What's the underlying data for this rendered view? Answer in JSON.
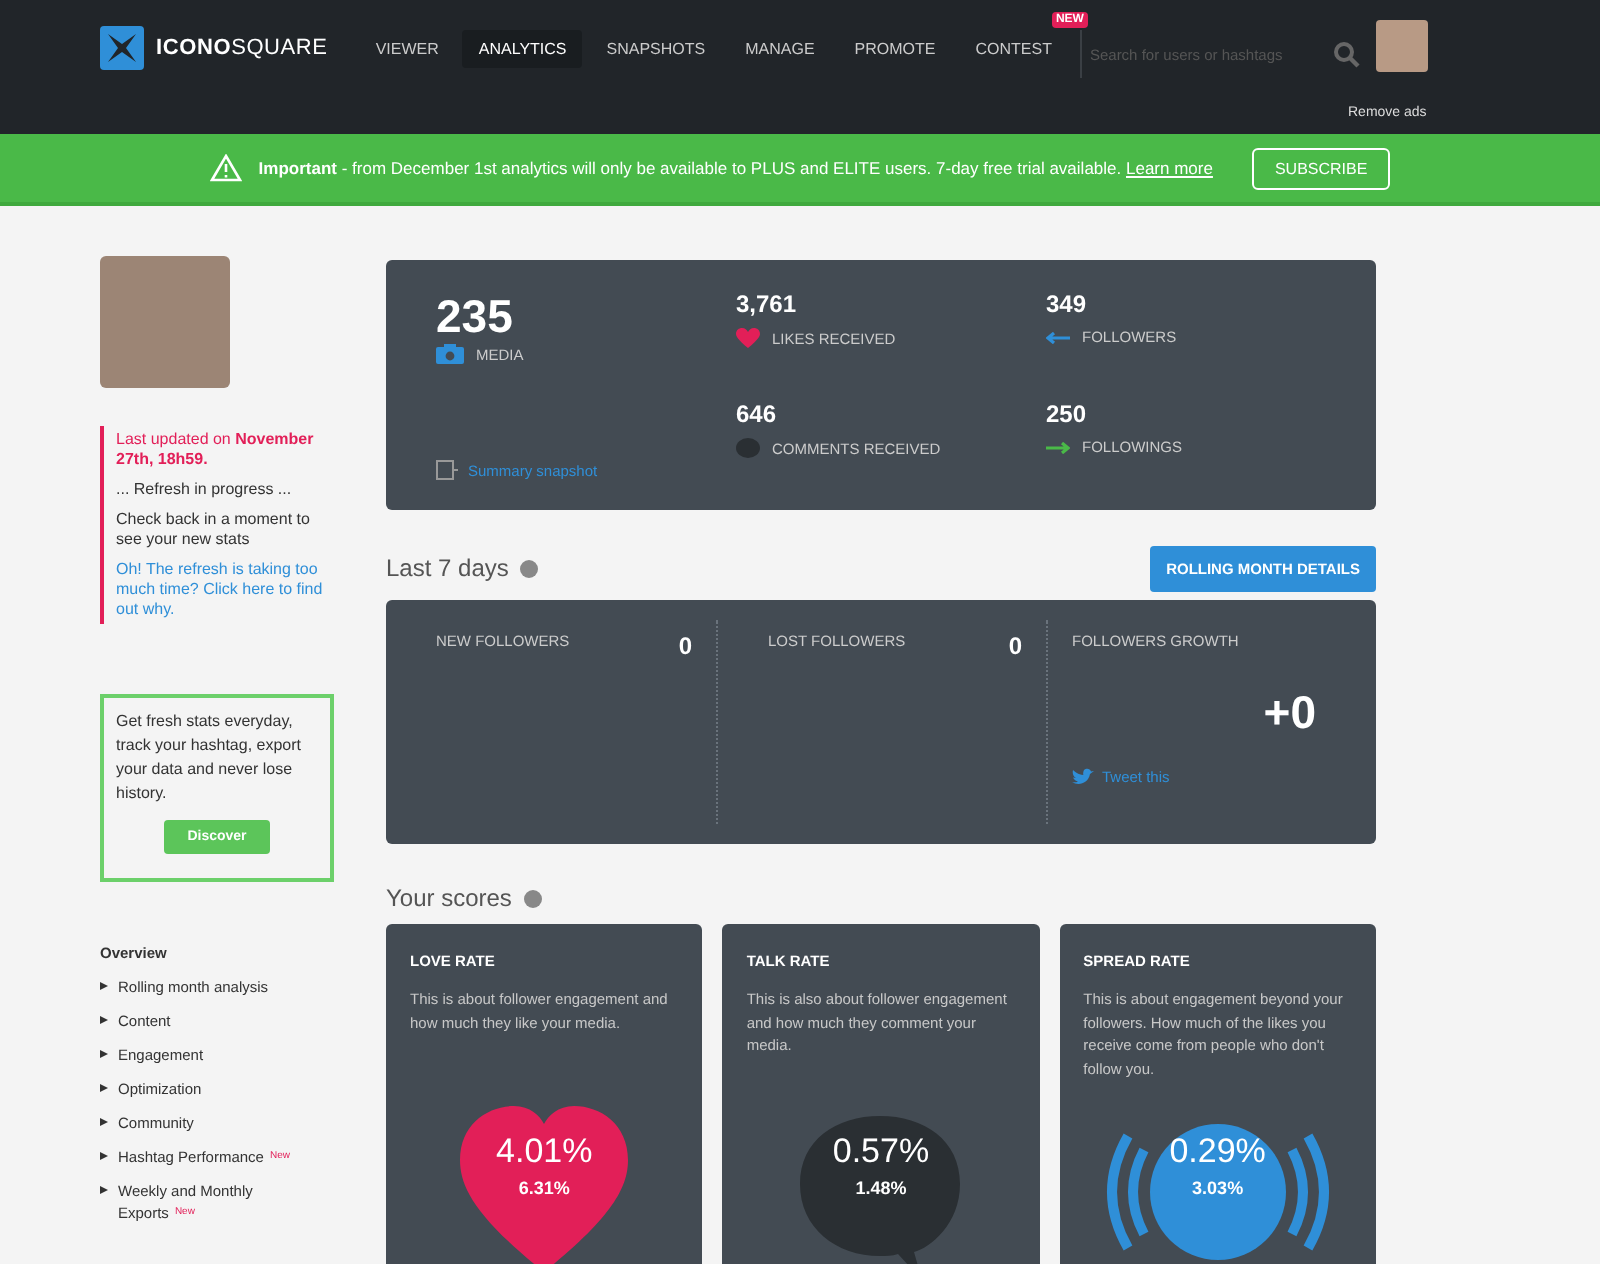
{
  "header": {
    "logo": {
      "bold": "ICONO",
      "light": "SQUARE"
    },
    "nav": [
      {
        "label": "VIEWER",
        "selected": false
      },
      {
        "label": "ANALYTICS",
        "selected": true
      },
      {
        "label": "SNAPSHOTS",
        "selected": false
      },
      {
        "label": "MANAGE",
        "selected": false
      },
      {
        "label": "PROMOTE",
        "selected": false
      },
      {
        "label": "CONTEST",
        "selected": false,
        "badge": "NEW"
      }
    ],
    "search": {
      "placeholder": "Search for users or hashtags"
    },
    "remove_ads": "Remove ads"
  },
  "banner": {
    "text": "**Important** - from December 1st analytics will only be available to PLUS and ELITE users. 7-day free trial available.",
    "link": "Learn more",
    "button": "SUBSCRIBE"
  },
  "sidebar": {
    "updated": "Last updated on **November 27th, 18h59.**",
    "progress": "... Refresh in progress ...",
    "check_back": "Check back in a moment to see your new stats",
    "help_link": "Oh! The refresh is taking too much time? Click here to find out why.",
    "promo": {
      "text": "Get fresh stats everyday, track your hashtag, export your data and never lose history.",
      "button": "Discover"
    },
    "items": [
      {
        "label": "Overview",
        "kind": "heading"
      },
      {
        "label": "Rolling month analysis",
        "kind": "item"
      },
      {
        "label": "Content",
        "kind": "item"
      },
      {
        "label": "Engagement",
        "kind": "item"
      },
      {
        "label": "Optimization",
        "kind": "item"
      },
      {
        "label": "Community",
        "kind": "item"
      },
      {
        "label": "Hashtag Performance",
        "kind": "item",
        "badge": "New"
      },
      {
        "label": "Weekly and Monthly Exports",
        "kind": "item",
        "badge": "New"
      }
    ]
  },
  "summary": {
    "media": {
      "value": "235",
      "label": "MEDIA"
    },
    "snapshot_link": "Summary snapshot",
    "stats": [
      {
        "value": "3,761",
        "label": "LIKES RECEIVED",
        "kind": "heart"
      },
      {
        "value": "349",
        "label": "FOLLOWERS",
        "kind": "arrow-left"
      },
      {
        "value": "646",
        "label": "COMMENTS RECEIVED",
        "kind": "bubble"
      },
      {
        "value": "250",
        "label": "FOLLOWINGS",
        "kind": "arrow-right"
      }
    ]
  },
  "last_7_days": {
    "title": "Last 7 days",
    "button": "ROLLING MONTH DETAILS",
    "cells": [
      {
        "label": "NEW FOLLOWERS",
        "value": "0"
      },
      {
        "label": "LOST FOLLOWERS",
        "value": "0"
      }
    ],
    "growth": {
      "label": "FOLLOWERS GROWTH",
      "value": "+0",
      "tweet": "Tweet this"
    }
  },
  "scores": {
    "title": "Your scores",
    "cards": [
      {
        "title": "LOVE RATE",
        "description": "This is about follower engagement and how much they like your media.",
        "value": "4.01%",
        "secondary": "6.31%",
        "kind": "heart"
      },
      {
        "title": "TALK RATE",
        "description": "This is also about follower engagement and how much they comment your media.",
        "value": "0.57%",
        "secondary": "1.48%",
        "kind": "bubble"
      },
      {
        "title": "SPREAD RATE",
        "description": "This is about engagement beyond your followers. How much of the likes you receive come from people who don't follow you.",
        "value": "0.29%",
        "secondary": "3.03%",
        "kind": "circle"
      }
    ]
  }
}
